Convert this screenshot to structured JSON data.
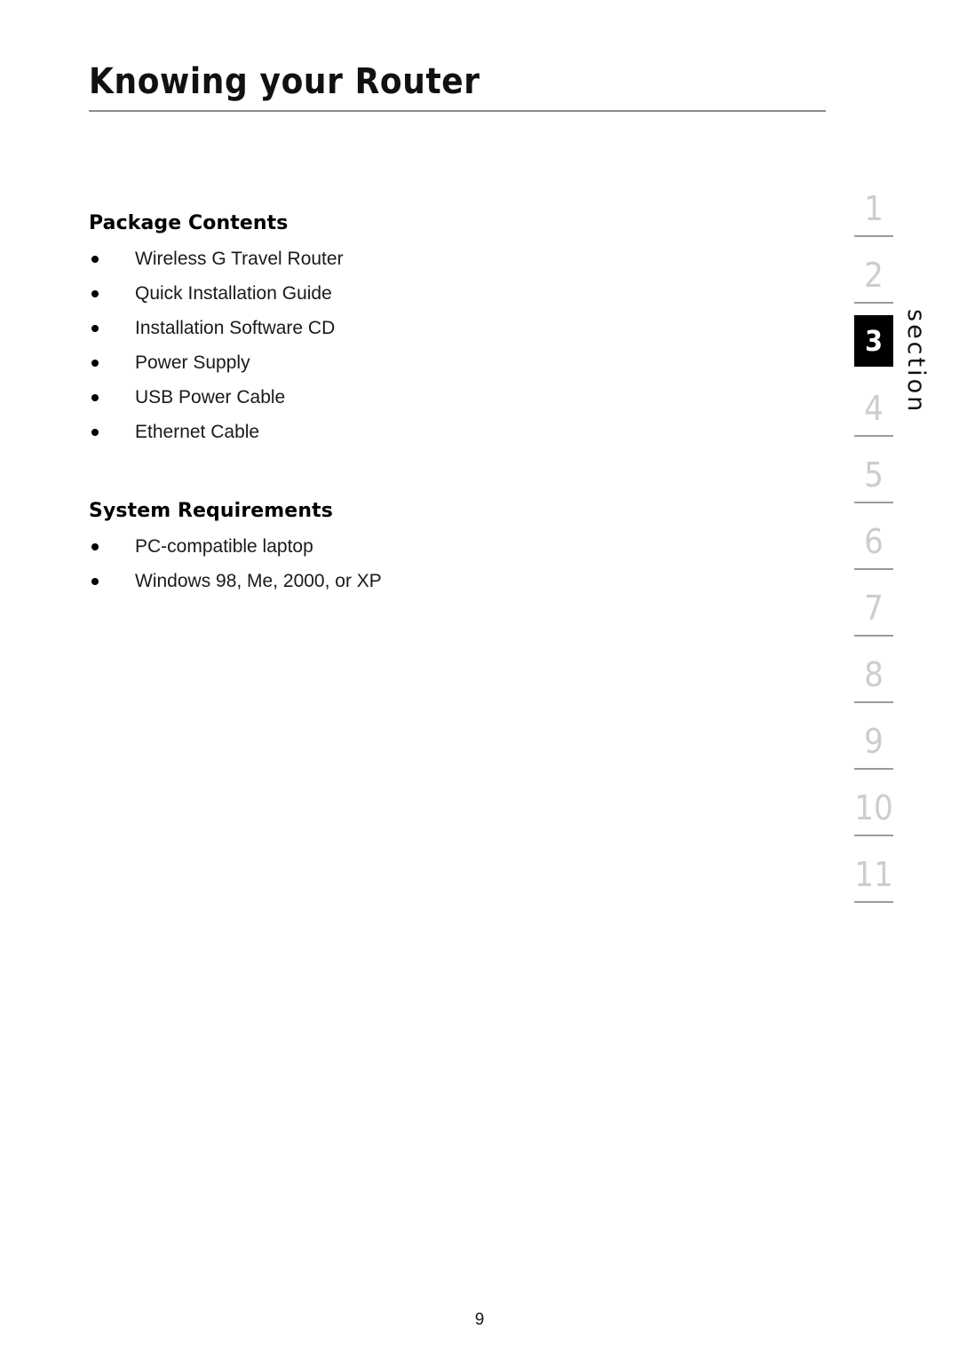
{
  "document": {
    "title": "Knowing your Router",
    "page_number": "9"
  },
  "sections": [
    {
      "heading": "Package Contents",
      "items": [
        "Wireless G Travel Router",
        "Quick Installation Guide",
        "Installation Software CD",
        "Power Supply",
        "USB Power Cable",
        "Ethernet Cable"
      ]
    },
    {
      "heading": "System Requirements",
      "items": [
        "PC-compatible laptop",
        "Windows 98, Me, 2000, or XP"
      ]
    }
  ],
  "section_tabs": {
    "label": "section",
    "active": "3",
    "numbers": [
      "1",
      "2",
      "3",
      "4",
      "5",
      "6",
      "7",
      "8",
      "9",
      "10",
      "11"
    ],
    "colors": {
      "inactive_number": "#cdcdcd",
      "active_background": "#000000",
      "active_number": "#ffffff",
      "rule": "#9a9a9a"
    }
  }
}
